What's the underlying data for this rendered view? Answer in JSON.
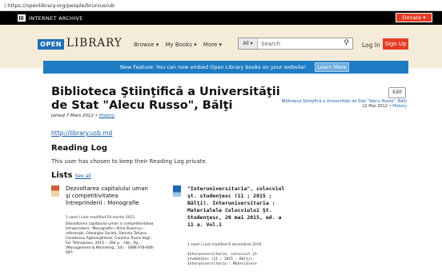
{
  "browser": {
    "url": "https://openlibrary.org/people/bruniusrub"
  },
  "ia_bar": {
    "title": "INTERNET ARCHIVE",
    "donate": "Donate ▾"
  },
  "header": {
    "logo_open": "OPEN",
    "logo_library": "LIBRARY",
    "nav": [
      "Browse ▾",
      "My Books ▾",
      "More ▾"
    ],
    "search_scope": "All ▾",
    "search_placeholder": "Search",
    "login": "Log In",
    "signup": "Sign Up"
  },
  "banner": {
    "message": "New Feature: You can now embed Open Library books on your website!",
    "learn_more": "Learn More"
  },
  "profile": {
    "title": "Biblioteca Ştiinţifică a Universităţii de Stat \"Alecu Russo\", Bălţi",
    "joined": "Joined 7 Mars 2012 •",
    "history_link": "History",
    "edit": "Edit",
    "last_edit_title": "Biblioteca Ştiinţifică a Universităţii de Stat \"Alecu Russo\", Bălţi",
    "last_edit_date": "12 Mar 2012 •",
    "last_edit_link": "History",
    "homepage": "http://library.usb.md",
    "reading_log_heading": "Reading Log",
    "reading_log_text": "This user has chosen to keep their Reading Log private.",
    "lists_heading": "Lists",
    "see_all": "See all"
  },
  "lists": [
    {
      "title": "Dezvoltarea capitalului uman şi competitivitatea întreprinderii : Monografie",
      "meta": "1 seed | Last modified 19 martie 2015",
      "description": "Dezvoltarea capitalului uman si competitivitatea întreprinderii : Monografie / Alina Buzenco ; referenţiţi: Gheorghe Sarafa, Daniela Tatiana Corodeanu Agheorghiesei, Carolina Tranic-Vagl ; Ed. Tehnopress, 2015. - 294 p. : tab., fig., - (Management & Marketing ; 54). - ISBN 978-606-687-"
    },
    {
      "title": "\"Interuniversitaria\", colocviul şt. studenţesc (11 ; 2015 ; Bălţi). Interuniversitaria : Materialele Colocviului Şt. Studenţesc, 20 mai 2015, ed. a 11 a. Vol.1",
      "meta": "1 seed | Last modified 6 decembrie 2016",
      "description": "Interuniversitaria, colocviul şt. studenţesc (11 ; 2015 ; Bălţi). Interuniversitaria : Materialele"
    }
  ]
}
